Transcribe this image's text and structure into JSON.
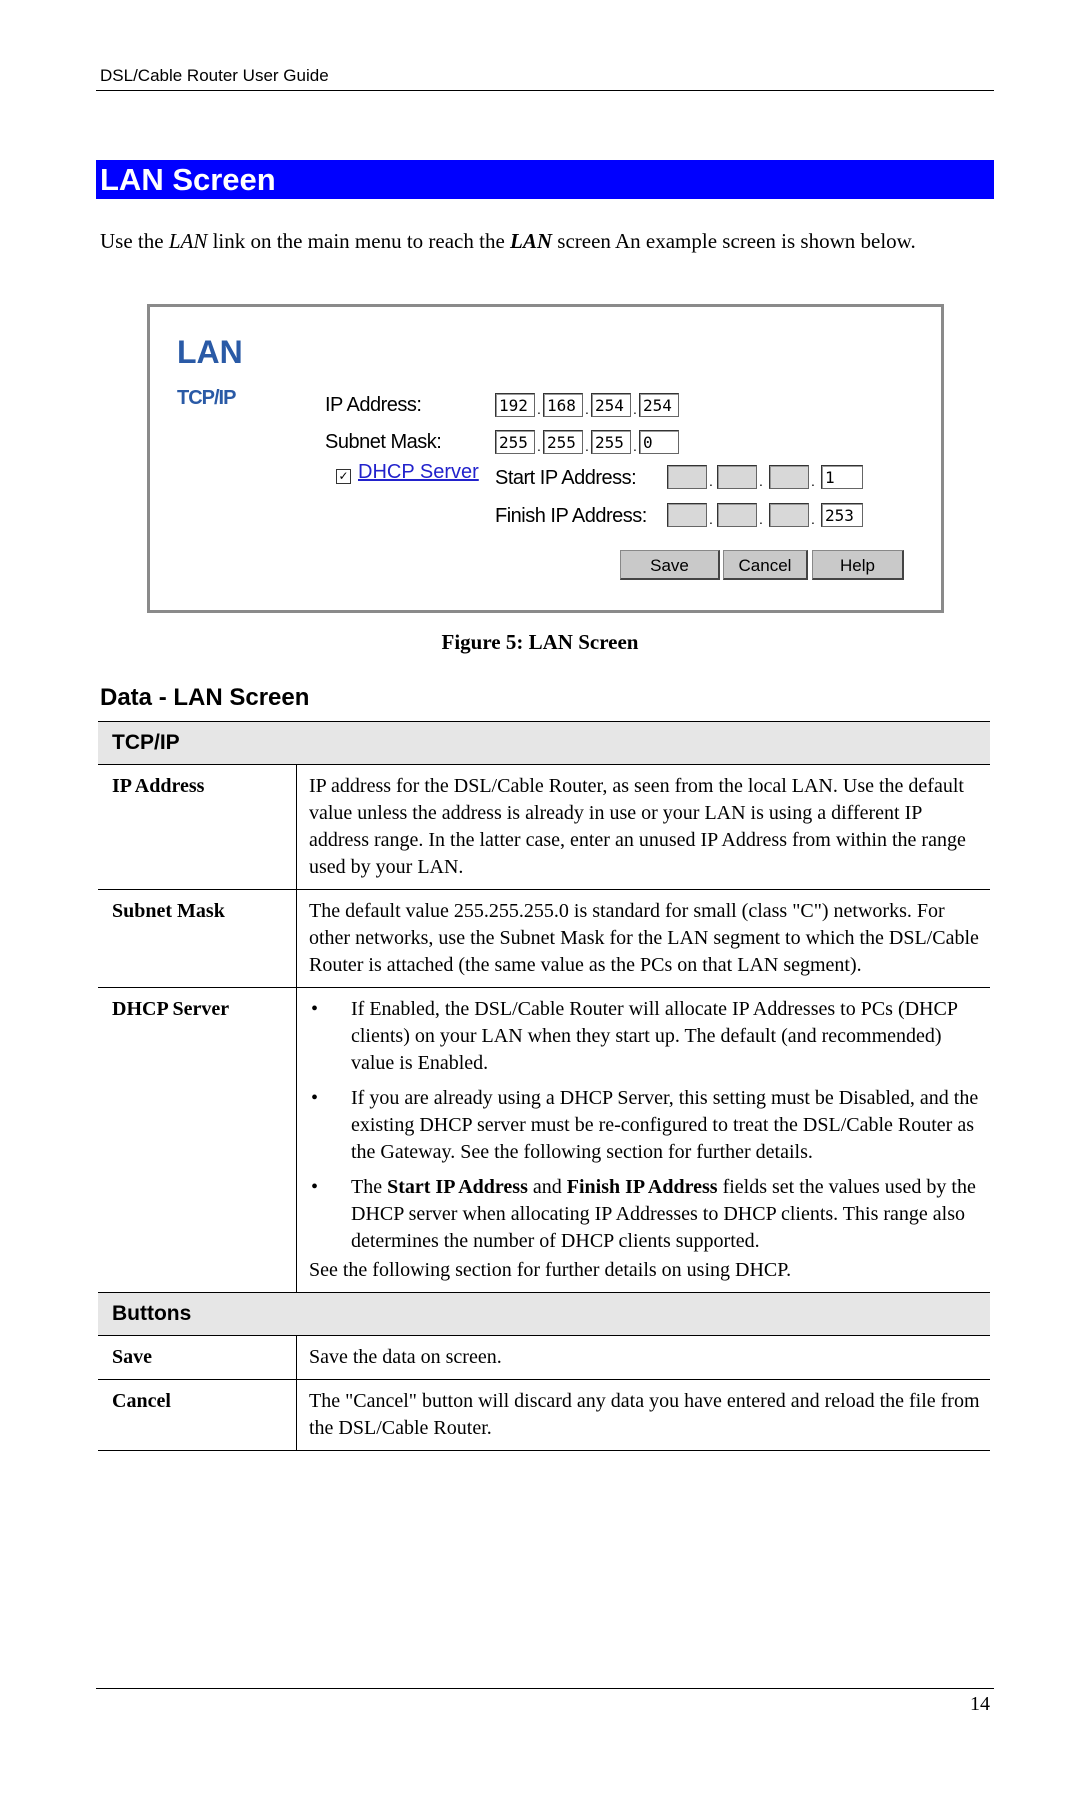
{
  "header": {
    "title": "DSL/Cable Router User Guide"
  },
  "section": {
    "title": "LAN Screen"
  },
  "intro": {
    "pre": "Use the ",
    "link1": "LAN",
    "mid": " link on the main menu to reach the ",
    "link2": "LAN",
    "post": " screen An example screen is shown below."
  },
  "figure": {
    "title": "LAN",
    "subtitle": "TCP/IP",
    "ip_label": "IP Address:",
    "ip_values": [
      "192",
      "168",
      "254",
      "254"
    ],
    "mask_label": "Subnet Mask:",
    "mask_values": [
      "255",
      "255",
      "255",
      "0"
    ],
    "dhcp_checked": true,
    "dhcp_link": "DHCP Server",
    "start_label": "Start IP Address:",
    "start_values": [
      "",
      "",
      "",
      "1"
    ],
    "finish_label": "Finish IP Address:",
    "finish_values": [
      "",
      "",
      "",
      "253"
    ],
    "buttons": {
      "save": "Save",
      "cancel": "Cancel",
      "help": "Help"
    },
    "caption": "Figure 5: LAN Screen"
  },
  "data_section": {
    "title": "Data - LAN Screen"
  },
  "table": {
    "group1": "TCP/IP",
    "ip_address": {
      "name": "IP Address",
      "desc": "IP address for the DSL/Cable Router, as seen from the local LAN. Use the default value unless the address is already in use or your LAN is using a different IP address range. In the latter case, enter an unused IP Address from within the range used by your LAN."
    },
    "subnet_mask": {
      "name": "Subnet Mask",
      "desc": "The default value 255.255.255.0 is standard for small (class \"C\") networks. For other networks, use the Subnet Mask for the LAN segment to which the DSL/Cable Router is attached (the same value as the PCs on that LAN segment)."
    },
    "dhcp_server": {
      "name": "DHCP Server",
      "bullet1": "If Enabled, the DSL/Cable Router will allocate IP Addresses to PCs (DHCP clients) on your LAN when they start up. The default (and recommended) value is Enabled.",
      "bullet2": "If you are already using a DHCP Server, this setting must be Disabled, and the existing DHCP server must be re-configured to treat the DSL/Cable Router as the Gateway. See the following section for further details.",
      "bullet3_pre": "The ",
      "bullet3_b1": "Start IP Address",
      "bullet3_mid": " and ",
      "bullet3_b2": "Finish IP Address",
      "bullet3_post": " fields set the values used by the DHCP server when allocating IP Addresses to DHCP clients. This range also determines the number of DHCP clients supported.",
      "footer": "See the following section for further details on using DHCP."
    },
    "group2": "Buttons",
    "save": {
      "name": "Save",
      "desc": "Save the data on screen."
    },
    "cancel": {
      "name": "Cancel",
      "desc": "The \"Cancel\" button will discard any data you have entered and reload the file from the DSL/Cable Router."
    }
  },
  "footer": {
    "page_number": "14"
  },
  "colors": {
    "banner": "#0000ff",
    "figure_heading": "#2a5aa6",
    "link": "#2222cc",
    "table_header_bg": "#e6e6e6"
  }
}
